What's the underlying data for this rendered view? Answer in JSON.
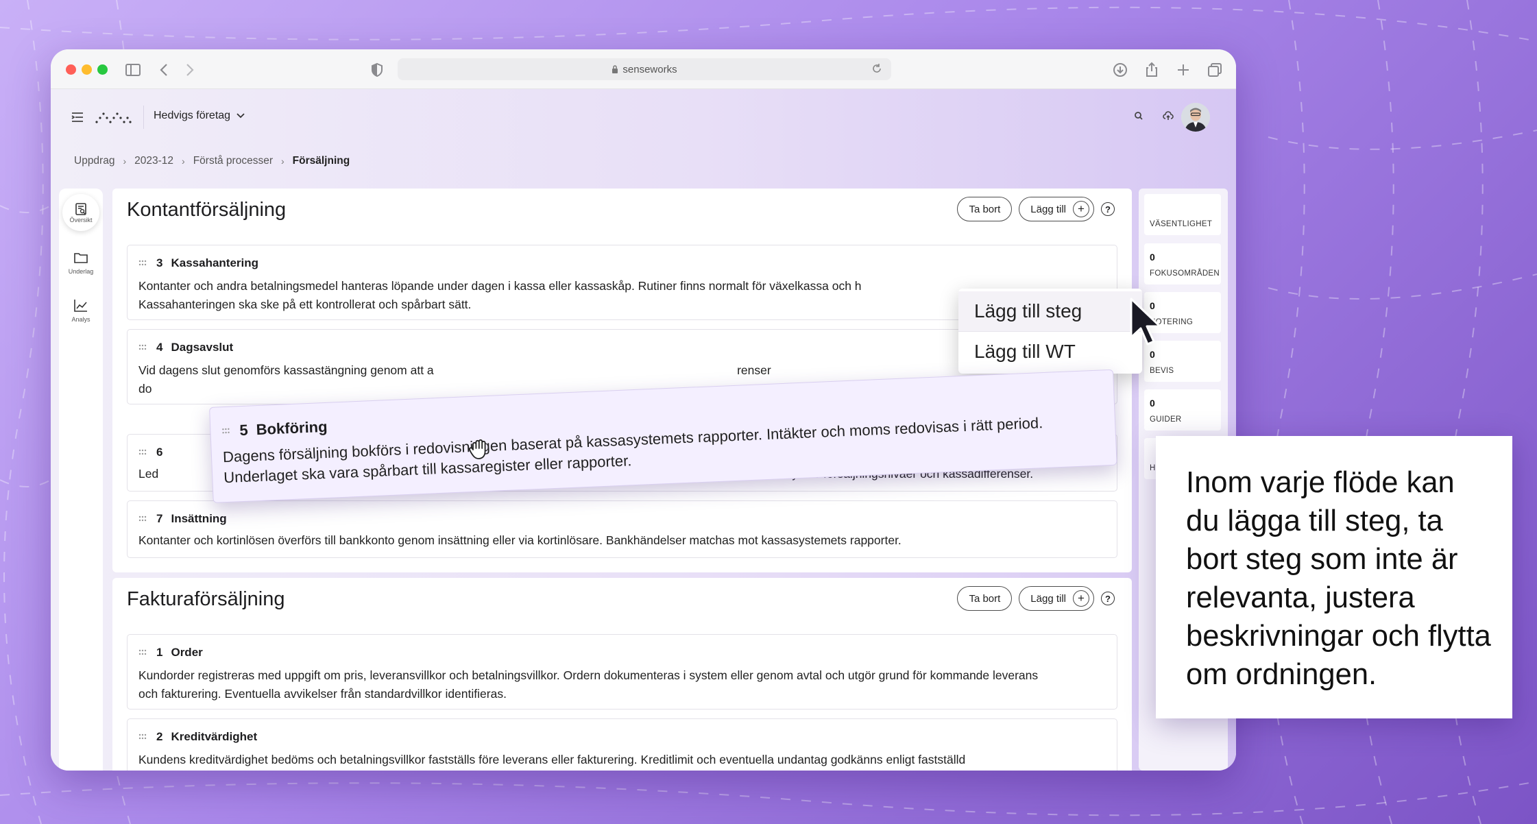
{
  "browser": {
    "address": "senseworks"
  },
  "topbar": {
    "company": "Hedvigs företag"
  },
  "breadcrumb": [
    "Uppdrag",
    "2023-12",
    "Förstå processer",
    "Försäljning"
  ],
  "leftnav": [
    {
      "label": "Översikt",
      "icon": "review-icon"
    },
    {
      "label": "Underlag",
      "icon": "folder-icon"
    },
    {
      "label": "Analys",
      "icon": "chart-icon"
    }
  ],
  "sections": [
    {
      "title": "Kontantförsäljning",
      "remove_label": "Ta bort",
      "add_label": "Lägg till",
      "steps": [
        {
          "num": "3",
          "title": "Kassahantering",
          "desc": "Kontanter och andra betalningsmedel hanteras löpande under dagen i kassa eller kassaskåp. Rutiner finns normalt för växelkassa och h\nKassahanteringen ska ske på ett kontrollerat och spårbart sätt."
        },
        {
          "num": "4",
          "title": "Dagsavslut",
          "desc": "Vid dagens slut genomförs kassastängning genom att a                                                                                           renser\ndo"
        },
        {
          "num": "6",
          "title": "",
          "desc": "Led                             ningsuppföljning och analyserar eventuella avvikelser. Uppföljningen kan exempelvis ske genom analys av försäljningsnivåer och kassadifferenser."
        },
        {
          "num": "7",
          "title": "Insättning",
          "desc": "Kontanter och kortinlösen överförs till bankkonto genom insättning eller via kortinlösare. Bankhändelser matchas mot kassasystemets rapporter."
        }
      ]
    },
    {
      "title": "Fakturaförsäljning",
      "remove_label": "Ta bort",
      "add_label": "Lägg till",
      "steps": [
        {
          "num": "1",
          "title": "Order",
          "desc": "Kundorder registreras med uppgift om pris, leveransvillkor och betalningsvillkor. Ordern dokumenteras i system eller genom avtal och utgör grund för kommande leverans\noch fakturering. Eventuella avvikelser från standardvillkor identifieras."
        },
        {
          "num": "2",
          "title": "Kreditvärdighet",
          "desc": "Kundens kreditvärdighet bedöms och betalningsvillkor fastställs före leverans eller fakturering. Kreditlimit och eventuella undantag godkänns enligt fastställd"
        }
      ]
    }
  ],
  "dragged_step": {
    "num": "5",
    "title": "Bokföring",
    "desc": "Dagens försäljning bokförs i redovisningen baserat på kassasystemets rapporter. Intäkter och moms redovisas i rätt period.\nUnderlaget ska vara spårbart till kassaregister eller rapporter."
  },
  "dropdown": {
    "options": [
      "Lägg till steg",
      "Lägg till WT"
    ]
  },
  "rightpanel": {
    "stats": [
      {
        "num": "",
        "label": "VÄSENTLIGHET"
      },
      {
        "num": "0",
        "label": "FOKUSOMRÅDEN"
      },
      {
        "num": "0",
        "label": "NOTERING"
      },
      {
        "num": "0",
        "label": "BEVIS"
      },
      {
        "num": "0",
        "label": "GUIDER"
      },
      {
        "num": "",
        "label": "H"
      }
    ]
  },
  "callout": {
    "text": "Inom varje flöde kan du lägga till steg, ta bort steg som inte är relevanta, justera beskrivningar och flytta om ordningen."
  },
  "colors": {
    "accent": "#a987ea",
    "background_dark": "#7c54c6"
  }
}
